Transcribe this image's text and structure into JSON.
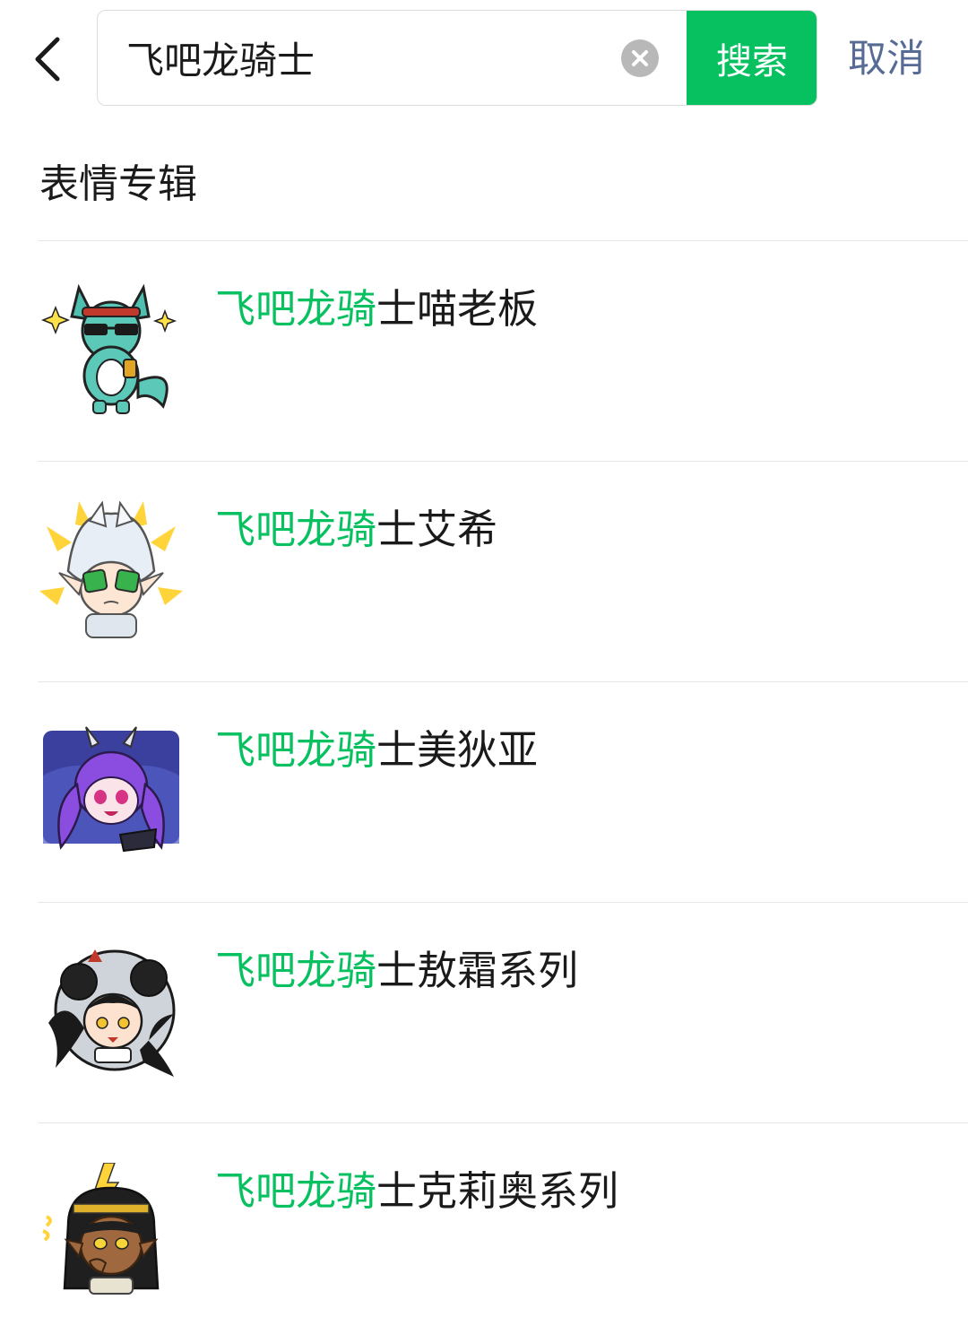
{
  "search": {
    "query": "飞吧龙骑士",
    "button_label": "搜索",
    "cancel_label": "取消"
  },
  "section": {
    "title": "表情专辑"
  },
  "colors": {
    "accent_green": "#07c160",
    "link_blue": "#576b95",
    "divider": "#e6e6e6"
  },
  "results": [
    {
      "highlight": "飞吧龙骑",
      "rest": "士喵老板",
      "thumb": "teal-cat-with-sunglasses-sticker"
    },
    {
      "highlight": "飞吧龙骑",
      "rest": "士艾希",
      "thumb": "silver-haired-elf-sticker"
    },
    {
      "highlight": "飞吧龙骑",
      "rest": "士美狄亚",
      "thumb": "purple-haired-horned-girl-sticker"
    },
    {
      "highlight": "飞吧龙骑",
      "rest": "士敖霜系列",
      "thumb": "dark-haired-dragon-girl-sticker"
    },
    {
      "highlight": "飞吧龙骑",
      "rest": "士克莉奥系列",
      "thumb": "egyptian-style-girl-sticker"
    }
  ]
}
